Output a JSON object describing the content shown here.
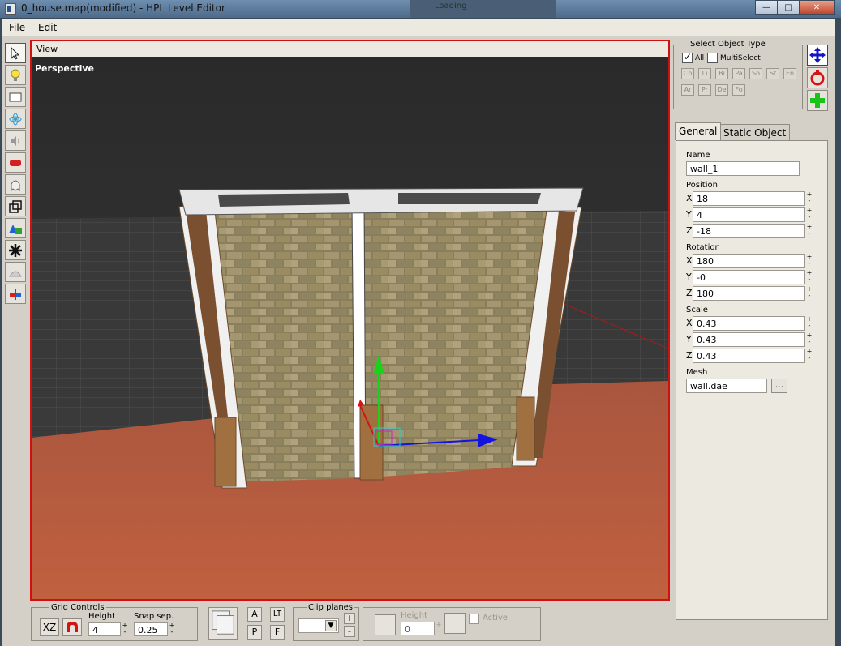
{
  "window": {
    "title": "0_house.map(modified) - HPL Level Editor",
    "background_window_text": "Loading",
    "minimize": "—",
    "maximize": "□",
    "close": "✕"
  },
  "menu": {
    "file": "File",
    "edit": "Edit"
  },
  "toolbar": {
    "tools": [
      "select-arrow-icon",
      "light-bulb-icon",
      "billboard-icon",
      "particle-icon",
      "sound-icon",
      "static-object-icon",
      "entity-ghost-icon",
      "area-cube-icon",
      "primitive-shapes-icon",
      "joint-star-icon",
      "decal-icon",
      "compound-icon"
    ]
  },
  "view": {
    "header": "View",
    "mode": "Perspective"
  },
  "select_object_type": {
    "title": "Select Object Type",
    "all_label": "All",
    "all_checked": true,
    "multiselect_label": "MultiSelect",
    "multiselect_checked": false,
    "types_row1": [
      "Co",
      "Li",
      "Bi",
      "Pa",
      "So",
      "St",
      "En"
    ],
    "types_row2": [
      "Ar",
      "Pr",
      "De",
      "Fo"
    ]
  },
  "tabs": {
    "general": "General",
    "static_object": "Static Object"
  },
  "general": {
    "name_label": "Name",
    "name_value": "wall_1",
    "position_label": "Position",
    "position": {
      "x": "18",
      "y": "4",
      "z": "-18"
    },
    "rotation_label": "Rotation",
    "rotation": {
      "x": "180",
      "y": "-0",
      "z": "180"
    },
    "scale_label": "Scale",
    "scale": {
      "x": "0.43",
      "y": "0.43",
      "z": "0.43"
    },
    "mesh_label": "Mesh",
    "mesh_value": "wall.dae",
    "browse": "...",
    "axis_x": "X",
    "axis_y": "Y",
    "axis_z": "Z",
    "spin_up": "+",
    "spin_down": "-"
  },
  "grid_controls": {
    "title": "Grid Controls",
    "plane_button": "XZ",
    "height_label": "Height",
    "height_value": "4",
    "snap_label": "Snap sep.",
    "snap_value": "0.25"
  },
  "view_buttons": {
    "a": "A",
    "lt": "LT",
    "p": "P",
    "f": "F"
  },
  "clip_planes": {
    "title": "Clip planes",
    "plus": "+",
    "minus": "-",
    "height_label": "Height",
    "height_value": "0",
    "active_label": "Active"
  },
  "colors": {
    "viewport_sky": "#2e2e2e",
    "floor": "#b8553b",
    "selection_border": "#d10f0f",
    "gizmo_y": "#1bd21b",
    "gizmo_x": "#1414e0"
  }
}
